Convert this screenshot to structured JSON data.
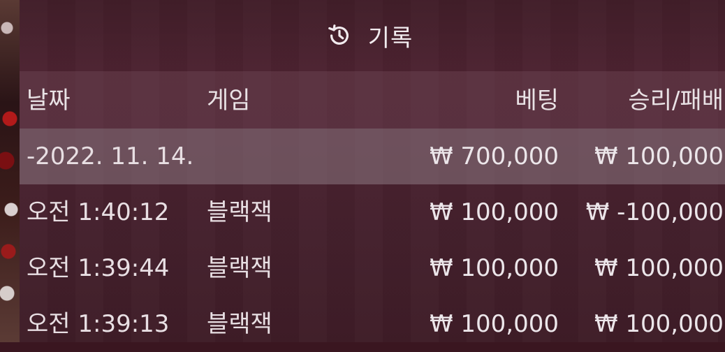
{
  "header": {
    "icon": "history-icon",
    "title": "기록"
  },
  "columns": {
    "date": "날짜",
    "game": "게임",
    "bet": "베팅",
    "result": "승리/패배"
  },
  "group": {
    "date": "-2022. 11. 14.",
    "bet": "₩ 700,000",
    "result": "₩ 100,000"
  },
  "rows": [
    {
      "time": "오전 1:40:12",
      "game": "블랙잭",
      "bet": "₩ 100,000",
      "result": "₩ -100,000"
    },
    {
      "time": "오전 1:39:44",
      "game": "블랙잭",
      "bet": "₩ 100,000",
      "result": "₩ 100,000"
    },
    {
      "time": "오전 1:39:13",
      "game": "블랙잭",
      "bet": "₩ 100,000",
      "result": "₩ 100,000"
    }
  ]
}
